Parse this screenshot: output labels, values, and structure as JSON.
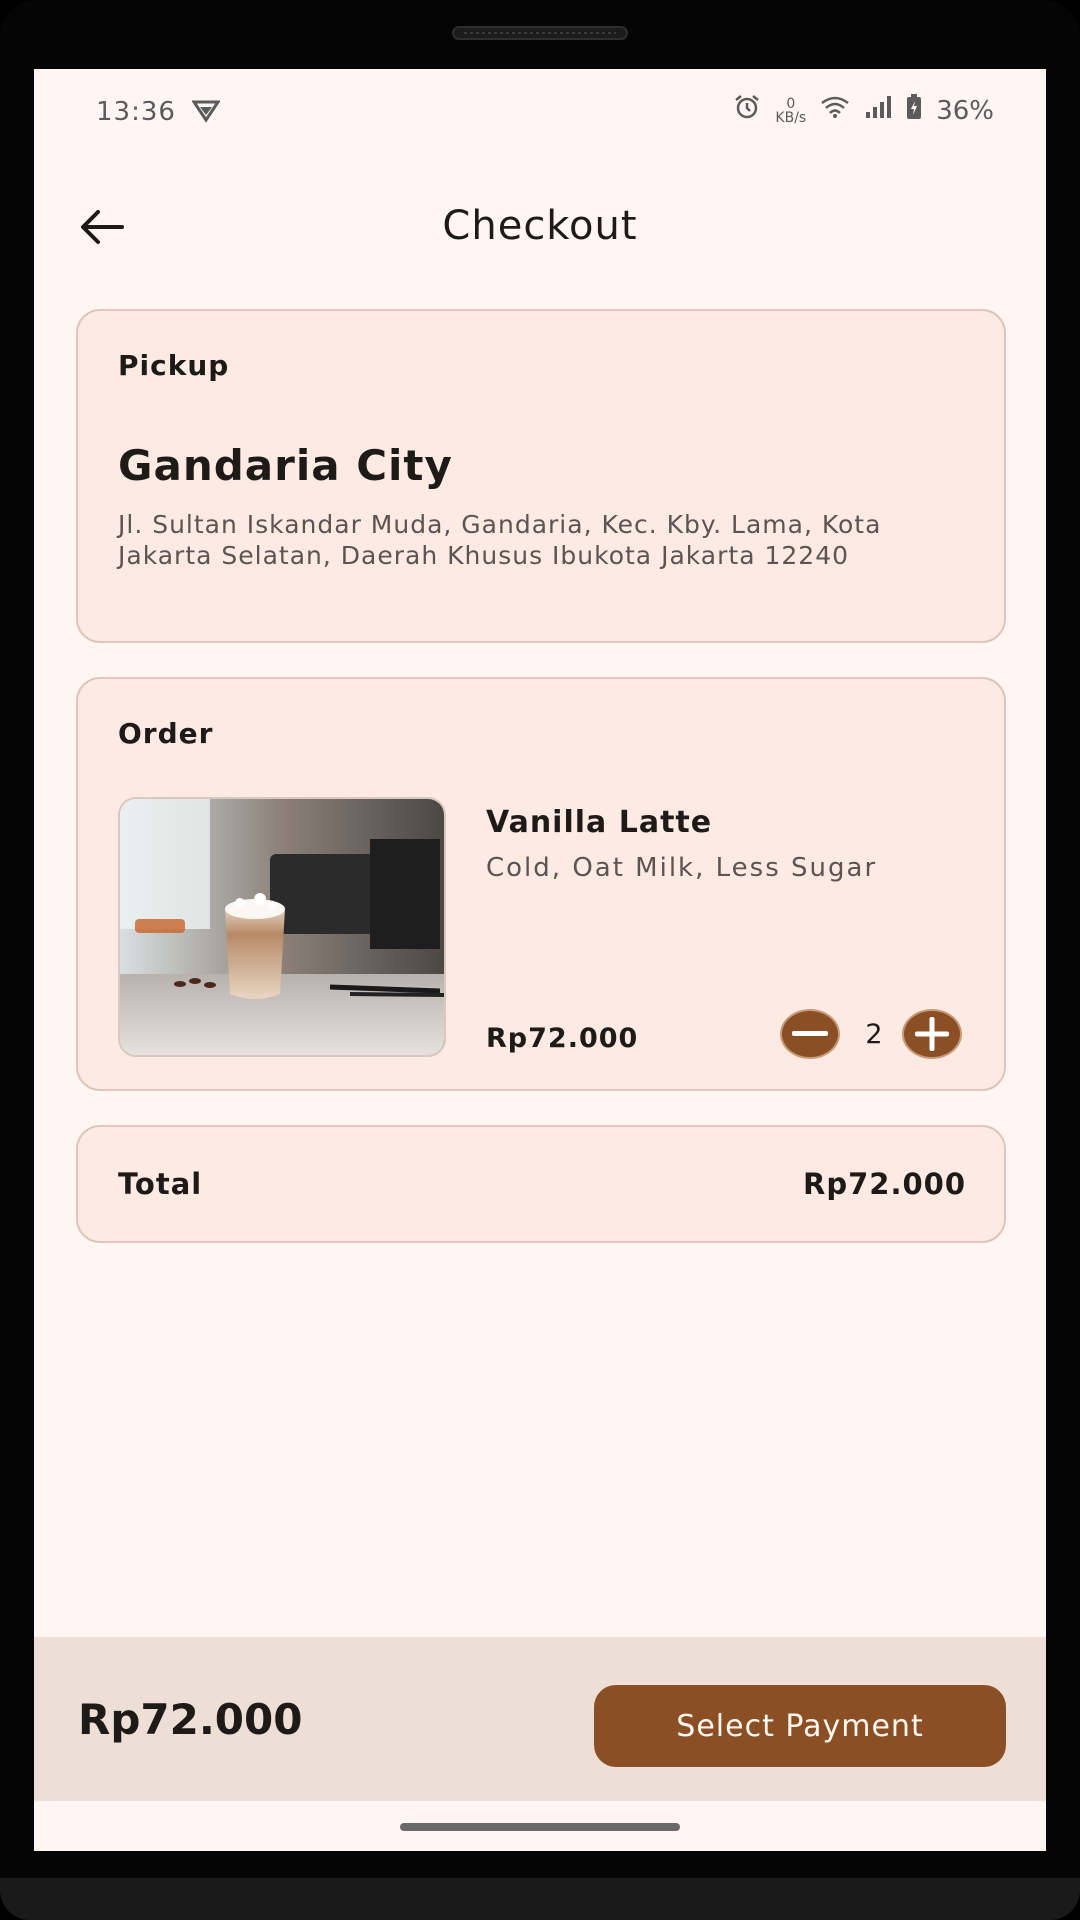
{
  "status_bar": {
    "time": "13:36",
    "net_speed_value": "0",
    "net_speed_unit": "KB/s",
    "battery": "36%"
  },
  "header": {
    "title": "Checkout"
  },
  "pickup": {
    "label": "Pickup",
    "store_name": "Gandaria City",
    "address": "Jl. Sultan Iskandar Muda, Gandaria, Kec. Kby. Lama, Kota Jakarta Selatan, Daerah Khusus Ibukota Jakarta 12240"
  },
  "order": {
    "label": "Order",
    "item": {
      "name": "Vanilla Latte",
      "options": "Cold, Oat Milk, Less Sugar",
      "price": "Rp72.000",
      "quantity": "2"
    }
  },
  "total": {
    "label": "Total",
    "value": "Rp72.000"
  },
  "footer": {
    "price": "Rp72.000",
    "button_label": "Select Payment"
  },
  "colors": {
    "accent": "#8b4f25",
    "card_bg": "#fdebe3",
    "screen_bg": "#fff6f3",
    "footer_bg": "#eedfd6"
  },
  "icons": [
    "back-arrow-icon",
    "vpn-icon",
    "alarm-icon",
    "wifi-icon",
    "signal-icon",
    "battery-icon",
    "minus-icon",
    "plus-icon"
  ]
}
